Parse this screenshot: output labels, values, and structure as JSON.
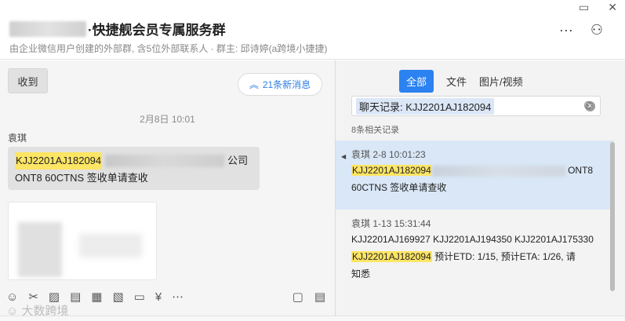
{
  "window": {
    "restore_glyph": "▭",
    "close_glyph": "✕"
  },
  "header": {
    "group_name": "·快捷舰会员专属服务群",
    "subtitle": "由企业微信用户创建的外部群, 含5位外部联系人 · 群主: 邱诗婷(a跨境小捷捷)",
    "more_glyph": "···",
    "add_member_glyph": "⚇"
  },
  "chat": {
    "received_button": "收到",
    "new_messages": "21条新消息",
    "new_messages_icon": "︽",
    "timestamp": "2月8日 10:01",
    "sender": "袁琪",
    "message": {
      "highlight": "KJJ2201AJ182094",
      "company_suffix": "公司",
      "line2": "ONT8 60CTNS 签收单请查收"
    }
  },
  "toolbar": {
    "emoji": "☺",
    "scissors": "✂",
    "image": "▨",
    "document": "▤",
    "grid": "▦",
    "photo": "▧",
    "folder": "▭",
    "money": "¥",
    "more": "⋯",
    "screen": "▢",
    "notes": "▤"
  },
  "watermark": "☺ 大数跨境",
  "search": {
    "tabs": [
      "全部",
      "文件",
      "图片/视频"
    ],
    "query": "聊天记录: KJJ2201AJ182094",
    "clear_glyph": "✕",
    "history_glyph": "⏲",
    "results_count": "8条相关记录",
    "results": [
      {
        "meta": "袁琪 2-8 10:01:23",
        "highlight": "KJJ2201AJ182094",
        "after_blur": "ONT8",
        "line2": "60CTNS 签收单请查收"
      },
      {
        "meta": "袁琪 1-13 15:31:44",
        "line1": "KJJ2201AJ169927 KJJ2201AJ194350 KJJ2201AJ175330",
        "highlight": "KJJ2201AJ182094",
        "line2_rest": " 预计ETD: 1/15, 预计ETA: 1/26, 请",
        "line3": "知悉"
      }
    ]
  },
  "colors": {
    "accent": "#2b82f0",
    "highlight": "#fde565",
    "selected_result": "#d9e7f7"
  }
}
